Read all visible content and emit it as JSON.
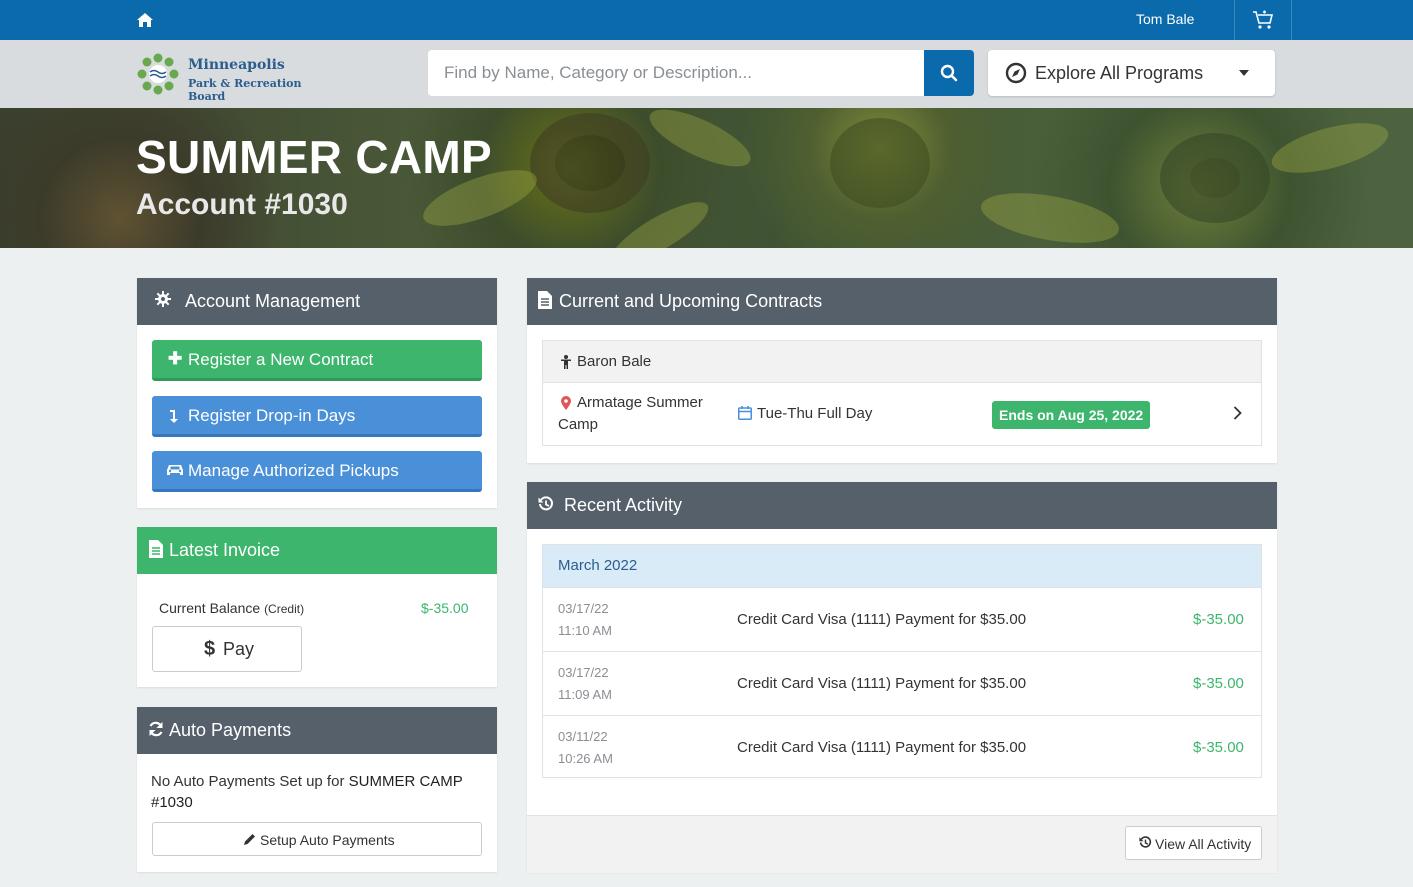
{
  "topbar": {
    "user_name": "Tom Bale"
  },
  "header": {
    "logo_line1": "Minneapolis",
    "logo_line2": "Park & Recreation Board",
    "search_placeholder": "Find by Name, Category or Description...",
    "explore_label": "Explore All Programs"
  },
  "hero": {
    "title": "SUMMER CAMP",
    "subtitle": "Account #1030"
  },
  "account_management": {
    "title": "Account Management",
    "buttons": [
      {
        "label": "Register a New Contract"
      },
      {
        "label": "Register Drop-in Days"
      },
      {
        "label": "Manage Authorized Pickups"
      }
    ]
  },
  "latest_invoice": {
    "title": "Latest Invoice",
    "balance_label": "Current Balance",
    "balance_note": "(Credit)",
    "balance_value": "$-35.00",
    "pay_label": "Pay",
    "pay_icon": "$"
  },
  "auto_payments": {
    "title": "Auto Payments",
    "text_prefix": "No Auto Payments Set up for",
    "text_strong": "SUMMER CAMP",
    "text_line2": "#1030",
    "setup_label": "Setup Auto Payments"
  },
  "contracts": {
    "title": "Current and Upcoming Contracts",
    "person": "Baron Bale",
    "location_line1": "Armatage Summer",
    "location_line2": "Camp",
    "schedule": "Tue-Thu Full Day",
    "status": "Ends on Aug 25, 2022"
  },
  "recent_activity": {
    "title": "Recent Activity",
    "month": "March 2022",
    "items": [
      {
        "date": "03/17/22",
        "time": "11:10 AM",
        "description": "Credit Card Visa (1111) Payment for $35.00",
        "amount": "$-35.00"
      },
      {
        "date": "03/17/22",
        "time": "11:09 AM",
        "description": "Credit Card Visa (1111) Payment for $35.00",
        "amount": "$-35.00"
      },
      {
        "date": "03/11/22",
        "time": "10:26 AM",
        "description": "Credit Card Visa (1111) Payment for $35.00",
        "amount": "$-35.00"
      }
    ],
    "view_all_label": "View All Activity"
  },
  "colors": {
    "primary": "#0a6aab",
    "success": "#3db56d",
    "info": "#4a90d9",
    "panel_header": "#56606b"
  }
}
